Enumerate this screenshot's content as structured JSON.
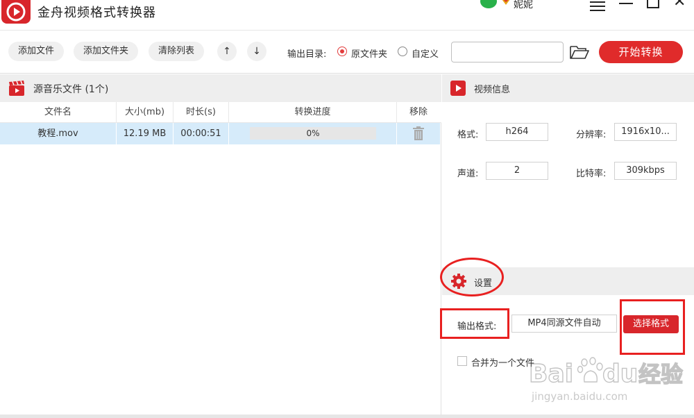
{
  "app": {
    "title": "金舟视频格式转换器",
    "user_name": "妮妮"
  },
  "toolbar": {
    "add_file": "添加文件",
    "add_folder": "添加文件夹",
    "clear_list": "清除列表",
    "move_up": "↑",
    "move_down": "↓",
    "output_dir_label": "输出目录:",
    "option_source": "原文件夹",
    "option_custom": "自定义",
    "path_value": "",
    "start_label": "开始转换"
  },
  "file_list": {
    "title": "源音乐文件 (1个)",
    "columns": [
      "文件名",
      "大小(mb)",
      "时长(s)",
      "转换进度",
      "移除"
    ],
    "rows": [
      {
        "name": "教程.mov",
        "size": "12.19 MB",
        "duration": "00:00:51",
        "progress": "0%"
      }
    ]
  },
  "video_info": {
    "title": "视频信息",
    "format_label": "格式:",
    "format_value": "h264",
    "resolution_label": "分辨率:",
    "resolution_value": "1916x10...",
    "channel_label": "声道:",
    "channel_value": "2",
    "bitrate_label": "比特率:",
    "bitrate_value": "309kbps"
  },
  "settings": {
    "title": "设置",
    "output_format_label": "输出格式:",
    "output_format_value": "MP4同源文件自动",
    "choose_format_label": "选择格式",
    "merge_label": "合并为一个文件"
  },
  "colors": {
    "accent": "#e02b2b",
    "row_selected": "#d6ebfa",
    "annotation": "#e82020"
  },
  "watermark": {
    "brand": "Bai",
    "brand2": "du",
    "brand_cn": "经验",
    "url": "jingyan.baidu.com"
  }
}
